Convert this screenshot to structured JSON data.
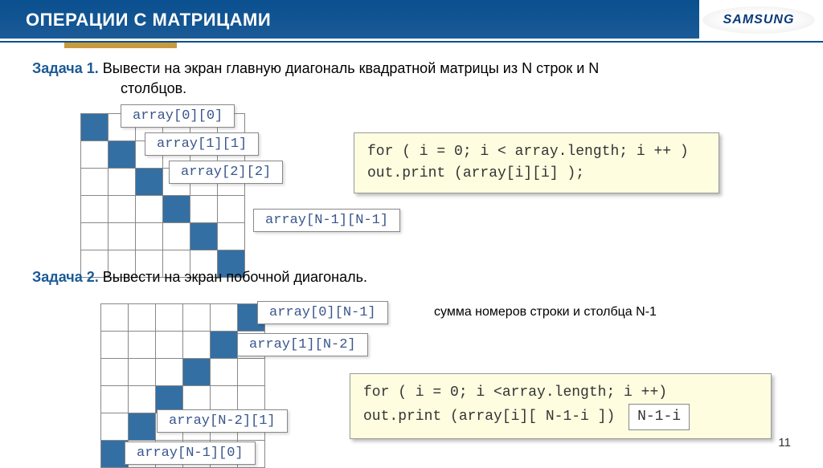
{
  "header": {
    "title": "ОПЕРАЦИИ С МАТРИЦАМИ",
    "brand": "SAMSUNG"
  },
  "task1": {
    "label": "Задача 1.",
    "text": "Вывести на экран главную диагональ квадратной матрицы из N строк и N",
    "text2": "столбцов.",
    "labels": {
      "a": "array[0][0]",
      "b": "array[1][1]",
      "c": "array[2][2]",
      "d": "array[N-1][N-1]"
    },
    "code": {
      "l1": "for ( i = 0;  i < array.length;  i ++ )",
      "l2": "  out.print (array[i][i] );"
    }
  },
  "task2": {
    "label": "Задача 2.",
    "text": "Вывести на экран побочной диагональ.",
    "note": "сумма номеров строки и столбца N-1",
    "labels": {
      "a": "array[0][N-1]",
      "b": "array[1][N-2]",
      "c": "array[N-2][1]",
      "d": "array[N-1][0]"
    },
    "code": {
      "l1": "for ( i = 0;  i <array.length;  i ++)",
      "l2": "  out.print (array[i][ N-1-i ])",
      "hl": "N-1-i"
    }
  },
  "pagenum": "11"
}
